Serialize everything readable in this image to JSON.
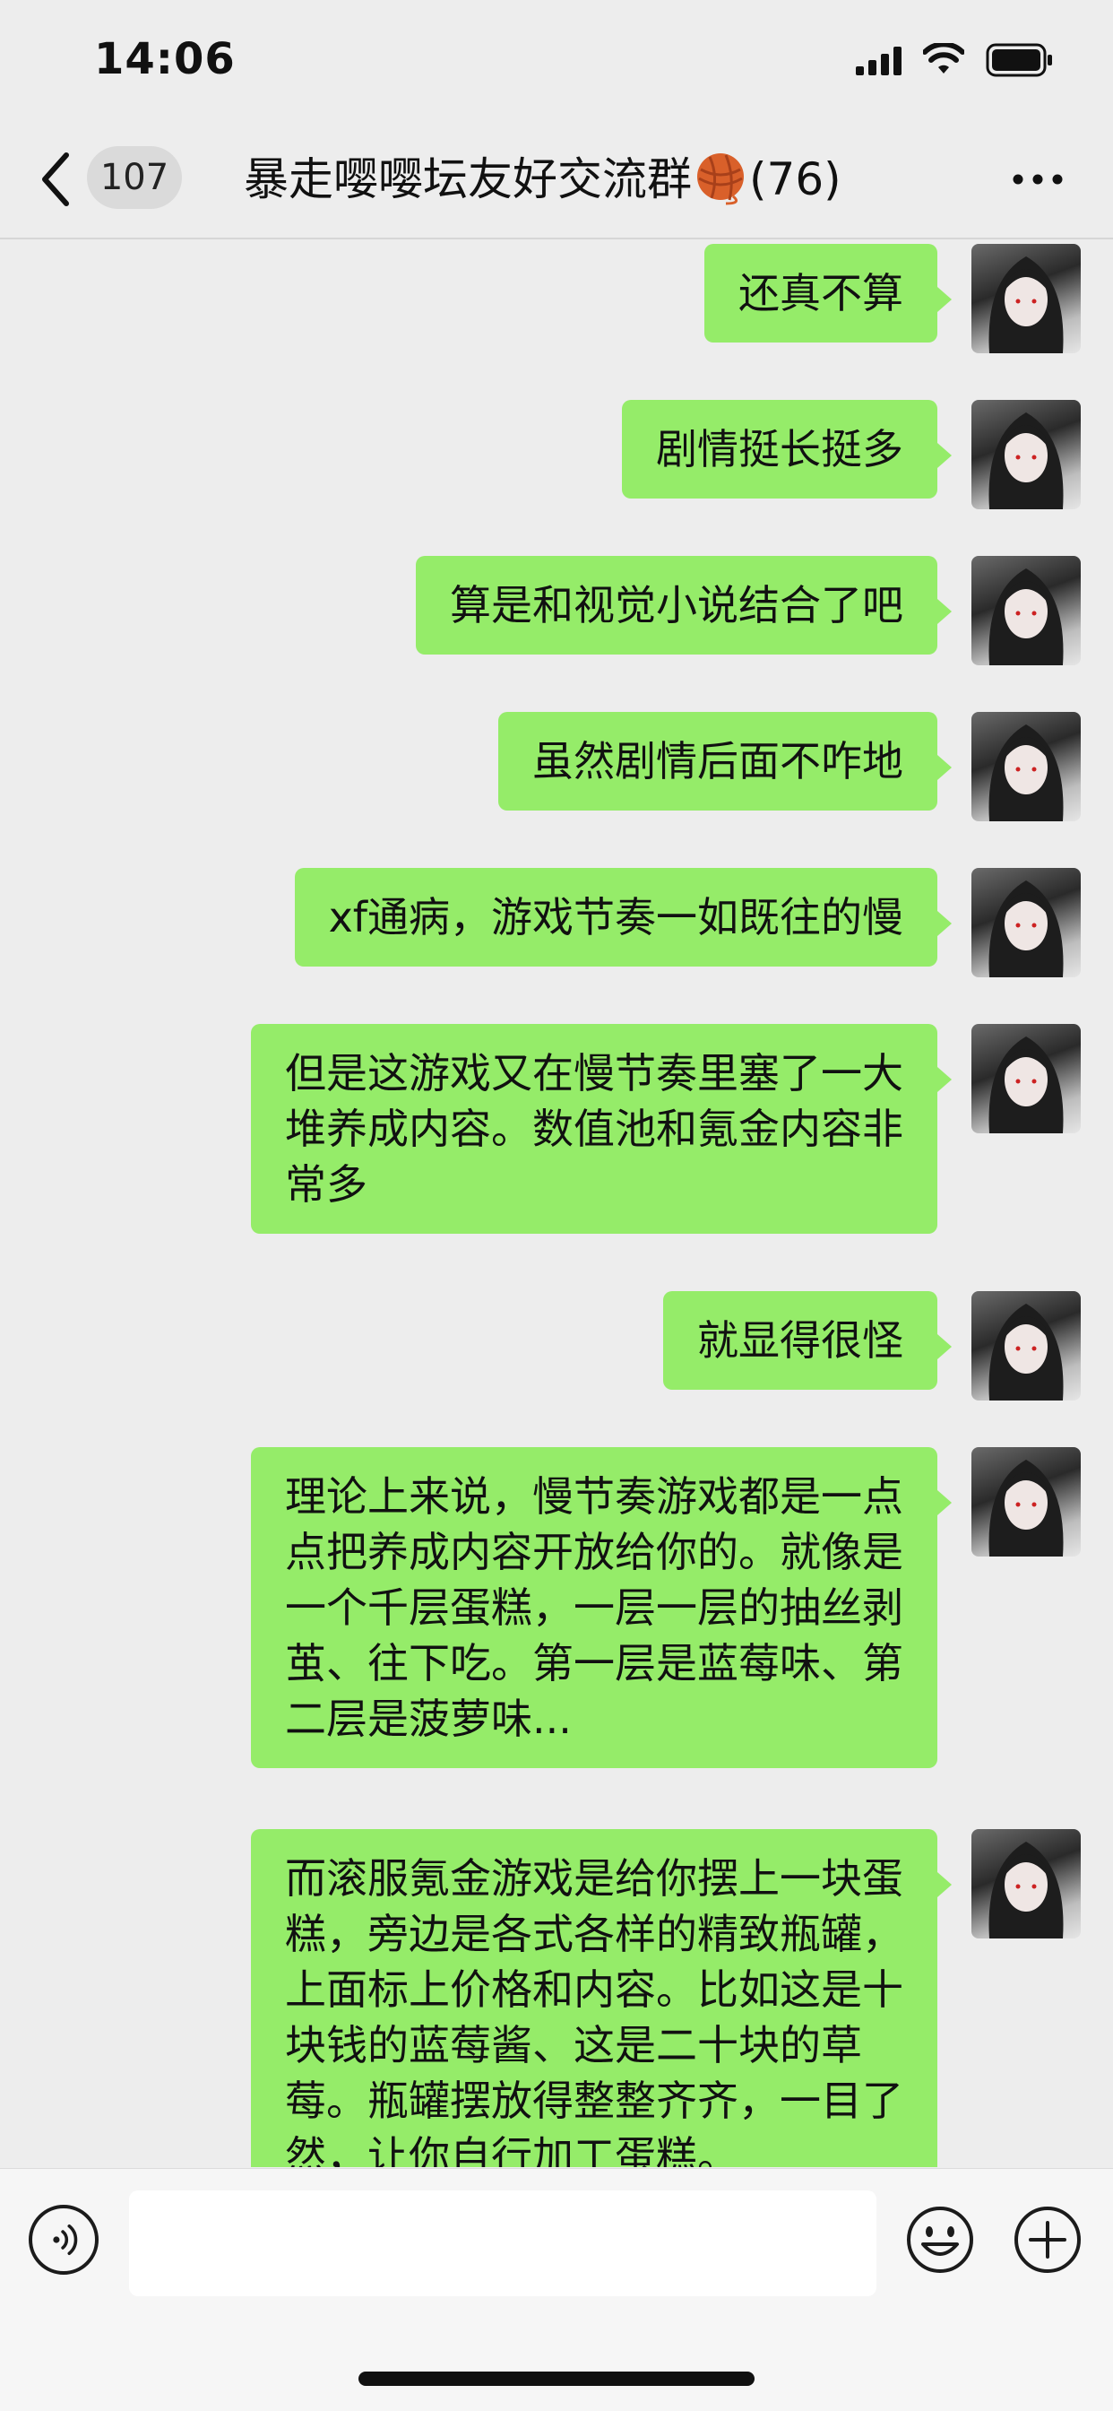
{
  "status_bar": {
    "time": "14:06"
  },
  "nav": {
    "unread_count": "107",
    "title_before": "暴走嘤嘤坛友好交流群",
    "title_after": "(76)"
  },
  "messages": [
    {
      "text": "还真不算"
    },
    {
      "text": "剧情挺长挺多"
    },
    {
      "text": "算是和视觉小说结合了吧"
    },
    {
      "text": "虽然剧情后面不咋地"
    },
    {
      "text": "xf通病，游戏节奏一如既往的慢"
    },
    {
      "text": "但是这游戏又在慢节奏里塞了一大\n堆养成内容。数值池和氪金内容非\n常多"
    },
    {
      "text": "就显得很怪"
    },
    {
      "text": "理论上来说，慢节奏游戏都是一点\n点把养成内容开放给你的。就像是\n一个千层蛋糕，一层一层的抽丝剥\n茧、往下吃。第一层是蓝莓味、第\n二层是菠萝味..."
    },
    {
      "text": "而滚服氪金游戏是给你摆上一块蛋\n糕，旁边是各式各样的精致瓶罐，\n上面标上价格和内容。比如这是十\n块钱的蓝莓酱、这是二十块的草\n莓。瓶罐摆放得整整齐齐，一目了\n然，让你自行加工蛋糕。"
    }
  ],
  "input": {
    "value": "",
    "placeholder": ""
  },
  "colors": {
    "bubble": "#95ec69",
    "background": "#ededed"
  },
  "icons": [
    "back-icon",
    "yarn-ball-icon",
    "more-icon",
    "voice-icon",
    "emoji-icon",
    "plus-icon",
    "signal-icon",
    "wifi-icon",
    "battery-icon"
  ]
}
